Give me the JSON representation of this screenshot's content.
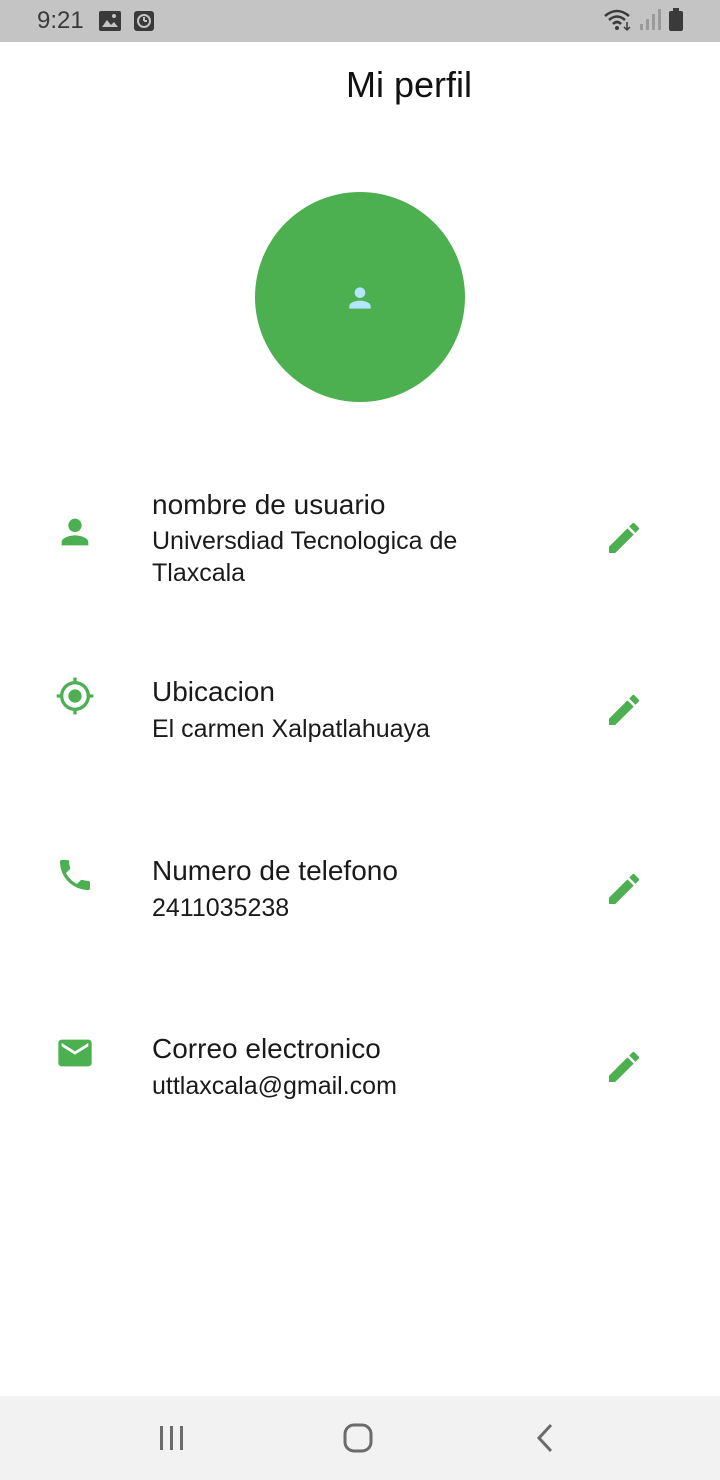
{
  "status_bar": {
    "time": "9:21",
    "left_icons": [
      "gallery-icon",
      "clock-icon"
    ],
    "right_icons": [
      "wifi-icon",
      "signal-icon",
      "battery-icon"
    ]
  },
  "header": {
    "title": "Mi perfil"
  },
  "colors": {
    "accent": "#4caf50",
    "avatar_icon": "#b3e5fc",
    "status_bar_bg": "#c4c4c4",
    "nav_bar_bg": "#f2f2f2"
  },
  "profile": {
    "avatar_icon": "person-icon",
    "fields": [
      {
        "icon": "person-icon",
        "label": "nombre de usuario",
        "value": "Universdiad Tecnologica de Tlaxcala",
        "action_icon": "edit-icon"
      },
      {
        "icon": "location-icon",
        "label": "Ubicacion",
        "value": "El carmen Xalpatlahuaya",
        "action_icon": "edit-icon"
      },
      {
        "icon": "phone-icon",
        "label": "Numero de telefono",
        "value": "2411035238",
        "action_icon": "edit-icon"
      },
      {
        "icon": "email-icon",
        "label": "Correo electronico",
        "value": "uttlaxcala@gmail.com",
        "action_icon": "edit-icon"
      }
    ]
  },
  "nav_bar": {
    "buttons": [
      "recent-apps-icon",
      "home-icon",
      "back-icon"
    ]
  }
}
